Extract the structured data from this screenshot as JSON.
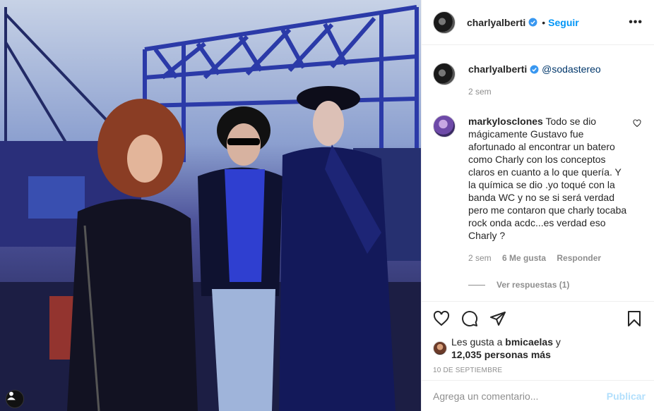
{
  "post": {
    "author": "charlyalberti",
    "follow_label": "Seguir",
    "dot": "•",
    "more_label": "•••",
    "caption_mention": "@sodastereo",
    "caption_time": "2 sem"
  },
  "comments": [
    {
      "user": "markylosclones",
      "text": "Todo se dio mágicamente Gustavo fue afortunado al encontrar un batero como Charly con los conceptos claros en cuanto a lo que quería. Y la química se dio .yo toqué con la banda WC y no se si será verdad pero me contaron que charly tocaba rock onda acdc...es verdad eso Charly ?",
      "time": "2 sem",
      "likes": "6 Me gusta",
      "reply_label": "Responder",
      "view_replies": "Ver respuestas (1)"
    }
  ],
  "likes": {
    "prefix": "Les gusta a",
    "user": "bmicaelas",
    "conjunction": "y",
    "count_text": "12,035 personas más"
  },
  "date": "10 DE SEPTIEMBRE",
  "add_comment": {
    "placeholder": "Agrega un comentario...",
    "publish_label": "Publicar"
  },
  "icons": {
    "verified": "verified-badge-icon",
    "like": "heart-icon",
    "comment": "comment-icon",
    "share": "paper-plane-icon",
    "save": "bookmark-icon",
    "tag": "person-tag-icon"
  },
  "colors": {
    "link": "#0095f6",
    "mention": "#00376b",
    "muted": "#8e8e8e",
    "publish_disabled": "#b2dffc"
  }
}
